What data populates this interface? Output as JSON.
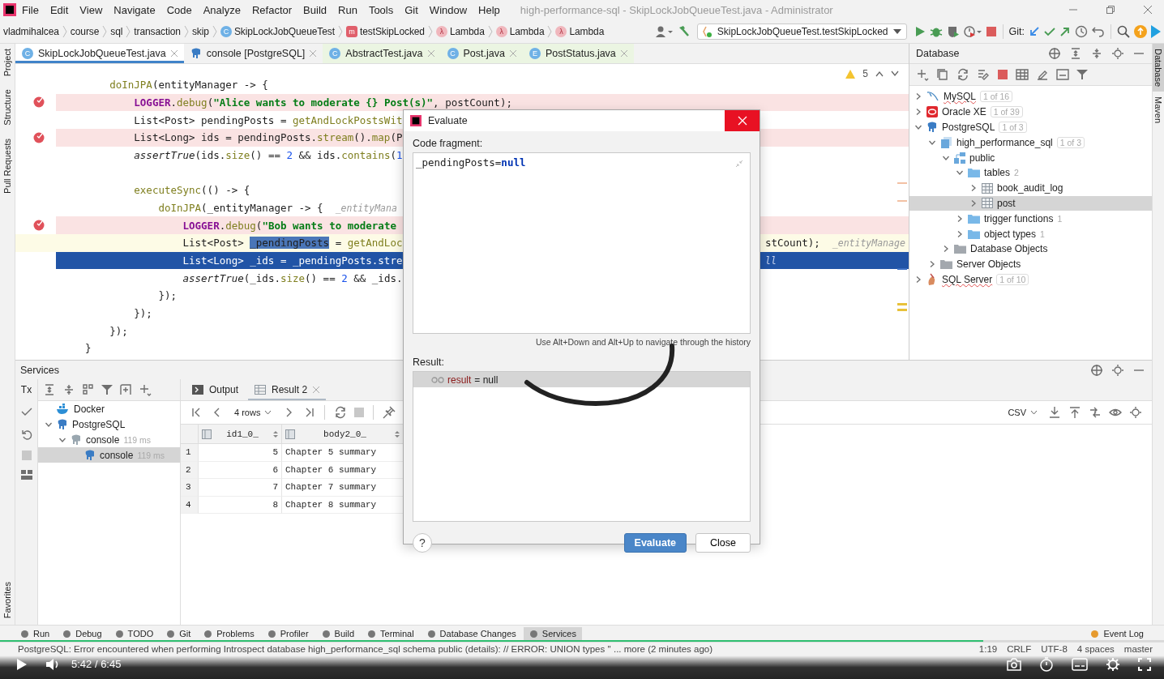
{
  "window": {
    "title": "high-performance-sql - SkipLockJobQueueTest.java - Administrator"
  },
  "menu": [
    "File",
    "Edit",
    "View",
    "Navigate",
    "Code",
    "Analyze",
    "Refactor",
    "Build",
    "Run",
    "Tools",
    "Git",
    "Window",
    "Help"
  ],
  "breadcrumbs": [
    {
      "label": "vladmihalcea",
      "kind": "package"
    },
    {
      "label": "course",
      "kind": "package"
    },
    {
      "label": "sql",
      "kind": "package"
    },
    {
      "label": "transaction",
      "kind": "package"
    },
    {
      "label": "skip",
      "kind": "package"
    },
    {
      "label": "SkipLockJobQueueTest",
      "kind": "class",
      "icon": "C"
    },
    {
      "label": "testSkipLocked",
      "kind": "method",
      "icon": "m"
    },
    {
      "label": "Lambda",
      "kind": "lambda",
      "icon": "λ"
    },
    {
      "label": "Lambda",
      "kind": "lambda",
      "icon": "λ"
    },
    {
      "label": "Lambda",
      "kind": "lambda",
      "icon": "λ"
    }
  ],
  "run_config": {
    "label": "SkipLockJobQueueTest.testSkipLocked"
  },
  "git_label": "Git:",
  "editor_tabs": [
    {
      "label": "SkipLockJobQueueTest.java",
      "kind": "class",
      "icon": "C",
      "selected": true
    },
    {
      "label": "console [PostgreSQL]",
      "kind": "console",
      "selected": false
    },
    {
      "label": "AbstractTest.java",
      "kind": "class",
      "icon": "C",
      "selected": false
    },
    {
      "label": "Post.java",
      "kind": "class",
      "icon": "C",
      "selected": false
    },
    {
      "label": "PostStatus.java",
      "kind": "enum",
      "icon": "E",
      "selected": false
    }
  ],
  "left_tool_tabs": [
    {
      "label": "Project",
      "selected": false
    },
    {
      "label": "Structure",
      "selected": false
    },
    {
      "label": "Pull Requests",
      "selected": false
    }
  ],
  "favorites_tab": "Favorites",
  "right_tool_tabs": [
    {
      "label": "Database",
      "selected": true
    },
    {
      "label": "Maven",
      "selected": false
    }
  ],
  "editor": {
    "warning_count": "5",
    "lines": [
      {
        "breakpoint": false,
        "current": false,
        "caret": false,
        "segments": [
          {
            "text": "        doInJPA",
            "kind": "method"
          },
          {
            "text": "(entityManager -> {",
            "kind": "plain"
          }
        ]
      },
      {
        "breakpoint": true,
        "current": false,
        "caret": false,
        "segments": [
          {
            "text": "            LOGGER",
            "kind": "field"
          },
          {
            "text": ".",
            "kind": "plain"
          },
          {
            "text": "debug",
            "kind": "method"
          },
          {
            "text": "(",
            "kind": "plain"
          },
          {
            "text": "\"Alice wants to moderate {} Post(s)\"",
            "kind": "string"
          },
          {
            "text": ", postCount);",
            "kind": "plain"
          }
        ]
      },
      {
        "breakpoint": false,
        "current": false,
        "caret": false,
        "segments": [
          {
            "text": "            List<Post> pendingPosts = ",
            "kind": "plain"
          },
          {
            "text": "getAndLockPostsWit",
            "kind": "method"
          }
        ]
      },
      {
        "breakpoint": true,
        "current": false,
        "caret": false,
        "segments": [
          {
            "text": "            List<Long> ids = pendingPosts.",
            "kind": "plain"
          },
          {
            "text": "stream",
            "kind": "method"
          },
          {
            "text": "().",
            "kind": "plain"
          },
          {
            "text": "map",
            "kind": "method"
          },
          {
            "text": "(P",
            "kind": "plain"
          }
        ]
      },
      {
        "breakpoint": false,
        "current": false,
        "caret": false,
        "segments": [
          {
            "text": "            assertTrue",
            "kind": "italic"
          },
          {
            "text": "(ids.",
            "kind": "plain"
          },
          {
            "text": "size",
            "kind": "method"
          },
          {
            "text": "() == ",
            "kind": "plain"
          },
          {
            "text": "2",
            "kind": "number"
          },
          {
            "text": " && ids.",
            "kind": "plain"
          },
          {
            "text": "contains",
            "kind": "method"
          },
          {
            "text": "(",
            "kind": "plain"
          },
          {
            "text": "1",
            "kind": "number"
          }
        ]
      },
      {
        "breakpoint": false,
        "current": false,
        "caret": false
      },
      {
        "breakpoint": false,
        "current": false,
        "caret": false,
        "segments": [
          {
            "text": "            executeSync",
            "kind": "method"
          },
          {
            "text": "(() -> {",
            "kind": "plain"
          }
        ]
      },
      {
        "breakpoint": false,
        "current": false,
        "caret": false,
        "segments": [
          {
            "text": "                doInJPA",
            "kind": "method"
          },
          {
            "text": "(_entityManager -> {  ",
            "kind": "plain"
          },
          {
            "text": "_entityMana",
            "kind": "hint"
          }
        ]
      },
      {
        "breakpoint": true,
        "current": false,
        "caret": false,
        "segments": [
          {
            "text": "                    LOGGER",
            "kind": "field"
          },
          {
            "text": ".",
            "kind": "plain"
          },
          {
            "text": "debug",
            "kind": "method"
          },
          {
            "text": "(",
            "kind": "plain"
          },
          {
            "text": "\"Bob wants to moderate ",
            "kind": "string"
          }
        ]
      },
      {
        "breakpoint": false,
        "current": false,
        "caret": true,
        "segments": [
          {
            "text": "                    List<Post> ",
            "kind": "plain"
          },
          {
            "text": "_pendingPosts",
            "kind": "match"
          },
          {
            "text": " = ",
            "kind": "plain"
          },
          {
            "text": "getAndLoc",
            "kind": "method"
          }
        ],
        "tail": [
          {
            "text": "stCount);  ",
            "kind": "plain"
          },
          {
            "text": "_entityManage",
            "kind": "hint"
          }
        ]
      },
      {
        "breakpoint": false,
        "current": true,
        "caret": false,
        "segments": [
          {
            "text": "                    List<Long> _ids = _pendingPosts.stre",
            "kind": "plain"
          }
        ],
        "tail": [
          {
            "text": "ll",
            "kind": "hint"
          }
        ]
      },
      {
        "breakpoint": false,
        "current": false,
        "caret": false,
        "segments": [
          {
            "text": "                    assertTrue",
            "kind": "italic"
          },
          {
            "text": "(_ids.",
            "kind": "plain"
          },
          {
            "text": "size",
            "kind": "method"
          },
          {
            "text": "() == ",
            "kind": "plain"
          },
          {
            "text": "2",
            "kind": "number"
          },
          {
            "text": " && _ids.",
            "kind": "plain"
          }
        ]
      },
      {
        "breakpoint": false,
        "current": false,
        "caret": false,
        "segments": [
          {
            "text": "                });",
            "kind": "plain"
          }
        ]
      },
      {
        "breakpoint": false,
        "current": false,
        "caret": false,
        "segments": [
          {
            "text": "            });",
            "kind": "plain"
          }
        ]
      },
      {
        "breakpoint": false,
        "current": false,
        "caret": false,
        "segments": [
          {
            "text": "        });",
            "kind": "plain"
          }
        ]
      },
      {
        "breakpoint": false,
        "current": false,
        "caret": false,
        "segments": [
          {
            "text": "    }",
            "kind": "plain"
          }
        ]
      }
    ]
  },
  "database": {
    "title": "Database",
    "tree": [
      {
        "label": "MySQL",
        "kind": "mysql",
        "badge": "1 of 16",
        "expanded": false,
        "selected": false
      },
      {
        "label": "Oracle XE",
        "kind": "oracle",
        "badge": "1 of 39",
        "expanded": false,
        "selected": false
      },
      {
        "label": "PostgreSQL",
        "kind": "postgres",
        "badge": "1 of 3",
        "expanded": true,
        "selected": false,
        "children": [
          {
            "label": "high_performance_sql",
            "kind": "database",
            "badge": "1 of 3",
            "expanded": true,
            "selected": false,
            "children": [
              {
                "label": "public",
                "kind": "schema",
                "expanded": true,
                "selected": false,
                "children": [
                  {
                    "label": "tables",
                    "kind": "folder",
                    "count": "2",
                    "expanded": true,
                    "selected": false,
                    "children": [
                      {
                        "label": "book_audit_log",
                        "kind": "table",
                        "expanded": false,
                        "selected": false
                      },
                      {
                        "label": "post",
                        "kind": "table",
                        "expanded": false,
                        "selected": true
                      }
                    ]
                  },
                  {
                    "label": "trigger functions",
                    "kind": "folder",
                    "count": "1",
                    "expanded": false,
                    "selected": false
                  },
                  {
                    "label": "object types",
                    "kind": "folder",
                    "count": "1",
                    "expanded": false,
                    "selected": false
                  }
                ]
              },
              {
                "label": "Database Objects",
                "kind": "grey-folder",
                "expanded": false,
                "selected": false
              }
            ]
          },
          {
            "label": "Server Objects",
            "kind": "grey-folder",
            "expanded": false,
            "selected": false
          }
        ]
      },
      {
        "label": "SQL Server",
        "kind": "sqlserver",
        "badge": "1 of 10",
        "expanded": false,
        "selected": false
      }
    ]
  },
  "services": {
    "title": "Services",
    "tx_label": "Tx",
    "tree": [
      {
        "label": "Docker",
        "kind": "docker",
        "selected": false
      },
      {
        "label": "PostgreSQL",
        "kind": "postgres",
        "expanded": true,
        "selected": false,
        "children": [
          {
            "label": "console",
            "kind": "console",
            "time": "119 ms",
            "expanded": true,
            "selected": false,
            "children": [
              {
                "label": "console",
                "kind": "postgres",
                "time": "119 ms",
                "selected": true
              }
            ]
          }
        ]
      }
    ],
    "tabs": [
      {
        "label": "Output",
        "kind": "output",
        "selected": false
      },
      {
        "label": "Result 2",
        "kind": "table",
        "selected": true
      }
    ],
    "rows_label": "4 rows",
    "format": "CSV",
    "columns": [
      "id1_0_",
      "body2_0_"
    ],
    "rows": [
      {
        "number": "1",
        "cells": [
          "5",
          "Chapter 5 summary"
        ]
      },
      {
        "number": "2",
        "cells": [
          "6",
          "Chapter 6 summary"
        ]
      },
      {
        "number": "3",
        "cells": [
          "7",
          "Chapter 7 summary"
        ]
      },
      {
        "number": "4",
        "cells": [
          "8",
          "Chapter 8 summary"
        ]
      }
    ]
  },
  "dialog": {
    "title": "Evaluate",
    "fragment_label": "Code fragment:",
    "fragment": [
      {
        "text": "_pendingPosts=",
        "kind": "plain"
      },
      {
        "text": "null",
        "kind": "keyword"
      }
    ],
    "history_hint": "Use Alt+Down and Alt+Up to navigate through the history",
    "result_label": "Result:",
    "result_name": "result",
    "result_value": "= null",
    "help": "?",
    "buttons": [
      {
        "label": "Evaluate",
        "primary": true
      },
      {
        "label": "Close",
        "primary": false
      }
    ]
  },
  "tool_windows": [
    {
      "label": "Run",
      "selected": false
    },
    {
      "label": "Debug",
      "selected": false
    },
    {
      "label": "TODO",
      "selected": false
    },
    {
      "label": "Git",
      "selected": false
    },
    {
      "label": "Problems",
      "selected": false
    },
    {
      "label": "Profiler",
      "selected": false
    },
    {
      "label": "Build",
      "selected": false
    },
    {
      "label": "Terminal",
      "selected": false
    },
    {
      "label": "Database Changes",
      "selected": false
    },
    {
      "label": "Services",
      "selected": true
    }
  ],
  "event_log": "Event Log",
  "status_bar": {
    "message": "PostgreSQL: Error encountered when performing Introspect database high_performance_sql schema public (details): // ERROR: UNION types '' ... more (2 minutes ago)",
    "items": [
      "1:19",
      "CRLF",
      "UTF-8",
      "4 spaces",
      "master"
    ]
  },
  "player": {
    "level": 0.845,
    "time": "5:42 / 6:45"
  }
}
